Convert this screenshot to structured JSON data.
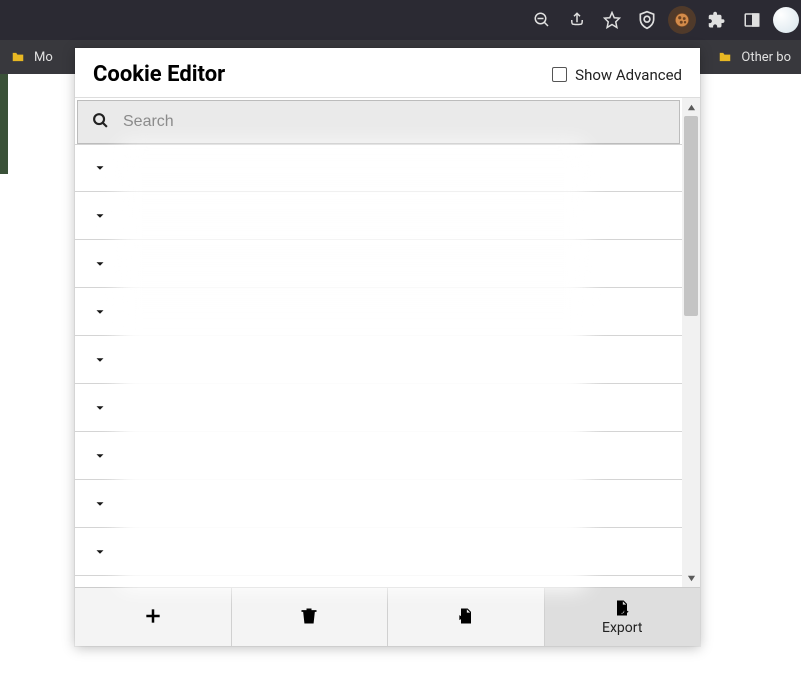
{
  "bookmarks": {
    "left_label": "Mo",
    "right_label": "Other bo"
  },
  "popup": {
    "title": "Cookie Editor",
    "show_advanced_label": "Show Advanced",
    "search_placeholder": "Search",
    "rows": [
      "",
      "",
      "",
      "",
      "",
      "",
      "",
      "",
      "",
      ""
    ],
    "footer": {
      "add_label": "",
      "delete_label": "",
      "import_label": "",
      "export_label": "Export"
    }
  }
}
